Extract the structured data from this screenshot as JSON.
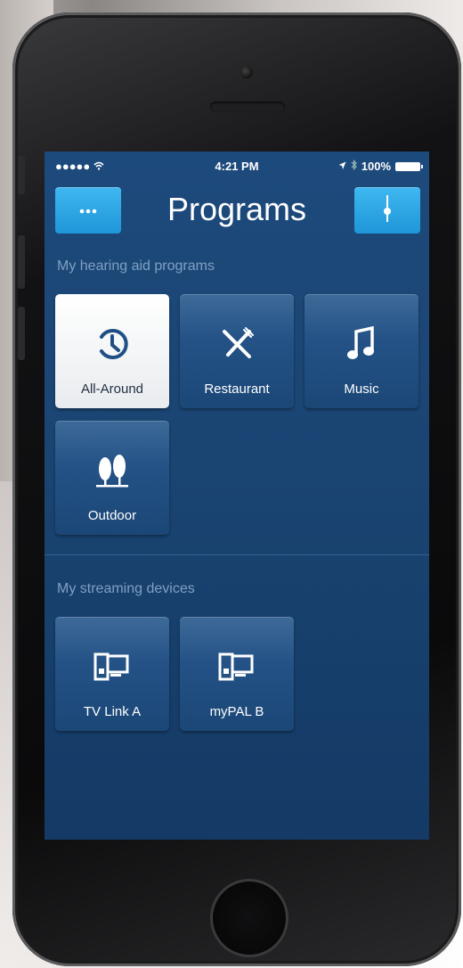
{
  "status_bar": {
    "signal": "●●●●● ",
    "time": "4:21 PM",
    "battery": "100%"
  },
  "nav": {
    "title": "Programs",
    "menu_icon": "more-dots-icon",
    "settings_icon": "slider-icon"
  },
  "programs_section": {
    "label": "My hearing aid programs",
    "items": [
      {
        "label": "All-Around",
        "icon": "dial-clock-icon",
        "selected": true
      },
      {
        "label": "Restaurant",
        "icon": "fork-knife-icon",
        "selected": false
      },
      {
        "label": "Music",
        "icon": "music-note-icon",
        "selected": false
      },
      {
        "label": "Outdoor",
        "icon": "trees-icon",
        "selected": false
      }
    ]
  },
  "streaming_section": {
    "label": "My streaming devices",
    "items": [
      {
        "label": "TV Link A",
        "icon": "tv-streamer-icon"
      },
      {
        "label": "myPAL B",
        "icon": "tv-streamer-icon"
      }
    ]
  },
  "colors": {
    "screen_bg": "#1a4472",
    "accent_button": "#2aa6e4",
    "selected_tile": "#f2f3f5"
  }
}
